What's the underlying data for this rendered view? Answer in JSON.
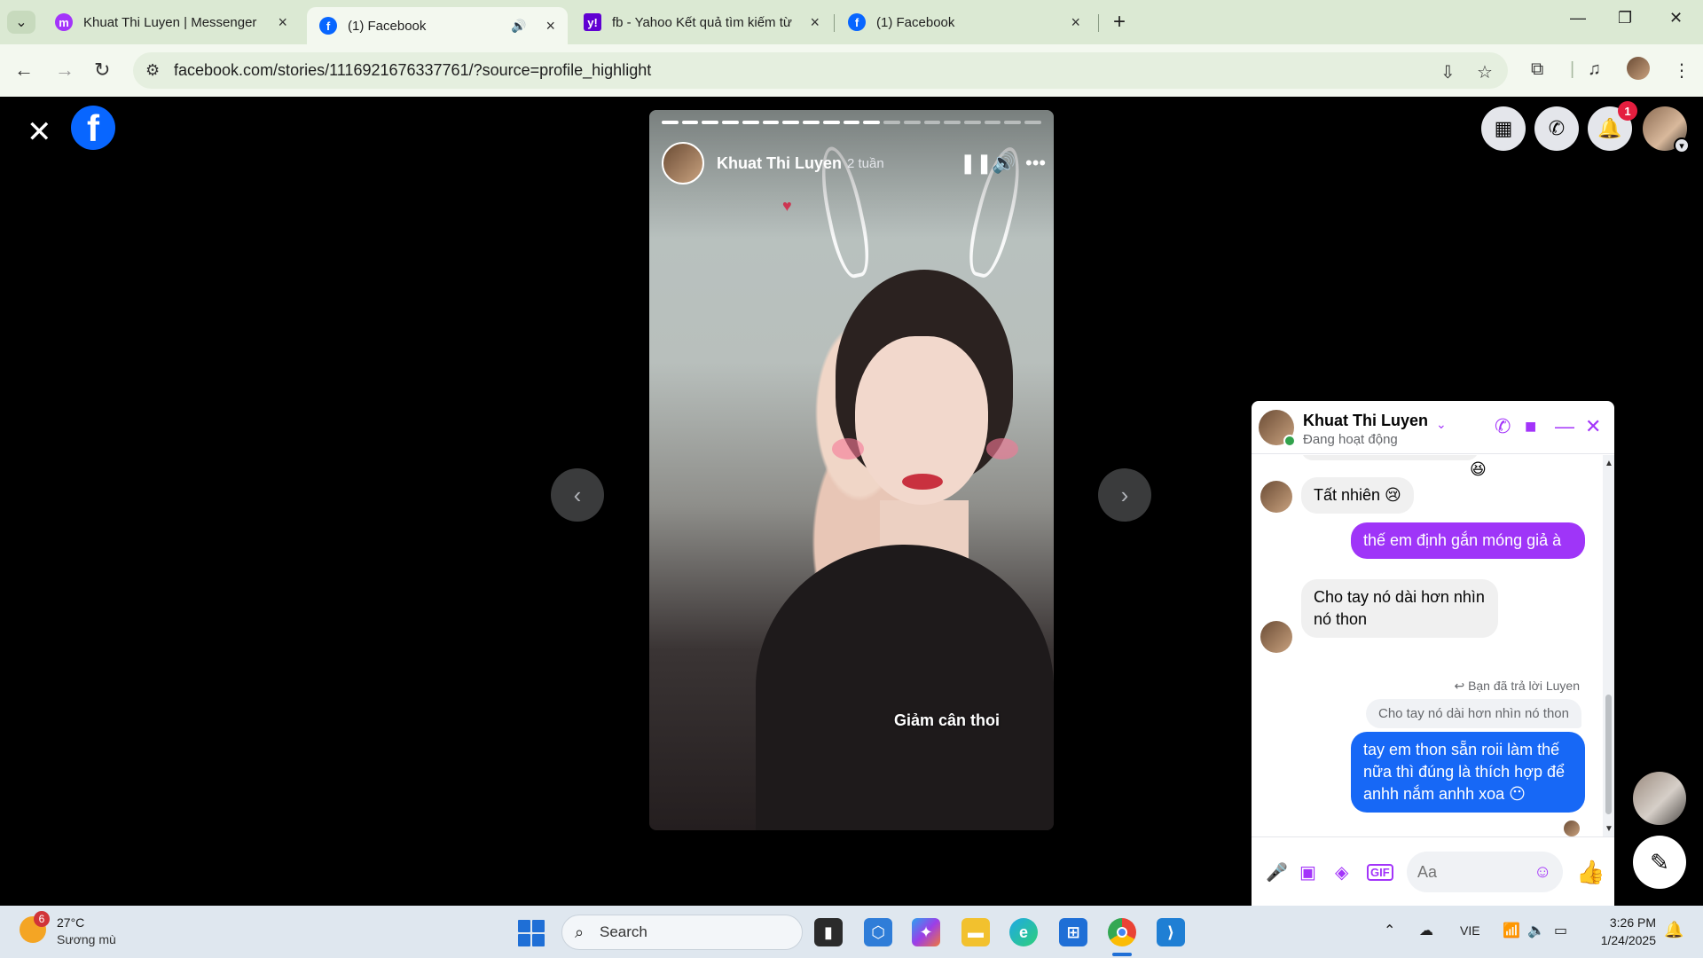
{
  "browser": {
    "tabs": [
      {
        "title": "Khuat Thi Luyen | Messenger",
        "favicon": "messenger-icon",
        "color": "#a334fa"
      },
      {
        "title": "(1) Facebook",
        "favicon": "facebook-icon",
        "color": "#0866ff",
        "active": true,
        "audio": true
      },
      {
        "title": "fb - Yahoo Kết quả tìm kiếm từ",
        "favicon": "yahoo-icon",
        "color": "#6001d2"
      },
      {
        "title": "(1) Facebook",
        "favicon": "facebook-icon",
        "color": "#0866ff"
      }
    ],
    "url": "facebook.com/stories/1116921676337761/?source=profile_highlight",
    "new_tab": "+",
    "chevron": "⌄"
  },
  "facebook": {
    "logo": "f",
    "notification_count": "1"
  },
  "story": {
    "author": "Khuat Thi Luyen",
    "time": "2 tuần",
    "caption": "Giảm cân thoi",
    "progress_total": 19,
    "progress_done": 11
  },
  "chat": {
    "name": "Khuat Thi Luyen",
    "status": "Đang hoạt động",
    "messages": [
      {
        "from": "them",
        "text": "Tất nhiên 😢"
      },
      {
        "from": "me",
        "text": "thế em định gắn móng giả à"
      },
      {
        "from": "them",
        "text": "Cho tay nó dài hơn nhìn nó thon"
      },
      {
        "from": "me",
        "text": "tay em thon sẵn roii làm thế nữa thì đúng là thích hợp để anhh nắm anhh xoa 😶"
      }
    ],
    "reply_note": "Bạn đã trả lời Luyen",
    "quoted": "Cho tay nó dài hơn nhìn nó thon",
    "top_emoji": "😆",
    "input_placeholder": "Aa"
  },
  "taskbar": {
    "weather_temp": "27°C",
    "weather_desc": "Sương mù",
    "weather_badge": "6",
    "search_label": "Search",
    "language": "VIE",
    "time": "3:26 PM",
    "date": "1/24/2025"
  },
  "colors": {
    "messenger_accent": "#a334fa",
    "facebook_blue": "#0866ff",
    "outgoing_purple": "#9f35f8",
    "outgoing_blue": "#1768f6"
  }
}
